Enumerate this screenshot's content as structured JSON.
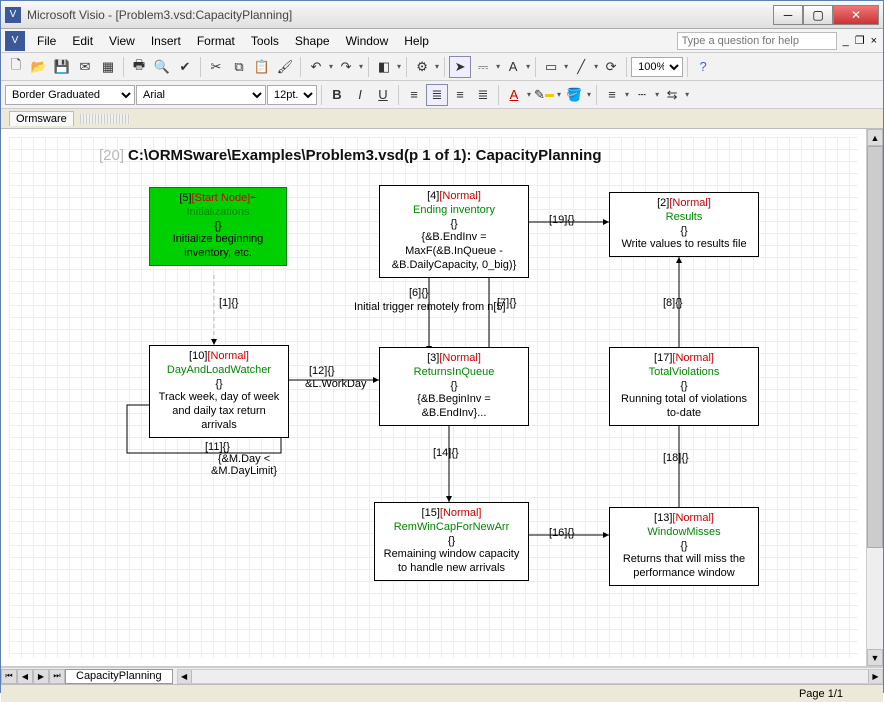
{
  "title_bar": {
    "title": "Microsoft Visio - [Problem3.vsd:CapacityPlanning]"
  },
  "menu": {
    "items": [
      "File",
      "Edit",
      "View",
      "Insert",
      "Format",
      "Tools",
      "Shape",
      "Window",
      "Help"
    ],
    "help_placeholder": "Type a question for help"
  },
  "toolbar": {
    "zoom": "100%"
  },
  "format_bar": {
    "style": "Border Graduated",
    "font": "Arial",
    "size": "12pt."
  },
  "shapes": {
    "tab": "Ormsware"
  },
  "document": {
    "prefix": "[20]",
    "path": "C:\\ORMSware\\Examples\\Problem3.vsd(p 1 of 1): CapacityPlanning"
  },
  "nodes": {
    "n5": {
      "id": "[5]",
      "type": "[Start Node]",
      "tilde": "~",
      "name": "Initializations",
      "br": "{}",
      "desc": "Initialize beginning inventory, etc."
    },
    "n4": {
      "id": "[4]",
      "type": "[Normal]",
      "name": "Ending inventory",
      "br": "{}",
      "desc": "{&B.EndInv = MaxF(&B.InQueue - &B.DailyCapacity, 0_big)}"
    },
    "n2": {
      "id": "[2]",
      "type": "[Normal]",
      "name": "Results",
      "br": "{}",
      "desc": "Write values to results file"
    },
    "n10": {
      "id": "[10]",
      "type": "[Normal]",
      "name": "DayAndLoadWatcher",
      "br": "{}",
      "desc": "Track week, day of week and daily tax return arrivals"
    },
    "n3": {
      "id": "[3]",
      "type": "[Normal]",
      "name": "ReturnsInQueue",
      "br": "{}",
      "desc": "{&B.BeginInv = &B.EndInv}..."
    },
    "n17": {
      "id": "[17]",
      "type": "[Normal]",
      "name": "TotalViolations",
      "br": "{}",
      "desc": "Running total of violations to-date"
    },
    "n15": {
      "id": "[15]",
      "type": "[Normal]",
      "name": "RemWinCapForNewArr",
      "br": "{}",
      "desc": "Remaining window capacity to handle new arrivals"
    },
    "n13": {
      "id": "[13]",
      "type": "[Normal]",
      "name": "WindowMisses",
      "br": "{}",
      "desc": "Returns that will miss the performance window"
    }
  },
  "edges": {
    "e1": {
      "id": "[1]",
      "txt": "{}"
    },
    "e6": {
      "id": "[6]",
      "txt": "{}",
      "sub": "Initial trigger remotely from n[5]"
    },
    "e7": {
      "id": "[7]",
      "txt": "{}"
    },
    "e8": {
      "id": "[8]",
      "txt": "{}"
    },
    "e11": {
      "id": "[11]",
      "txt": "{}",
      "sub": "{&M.Day < &M.DayLimit}"
    },
    "e12": {
      "id": "[12]",
      "txt": "{}",
      "sub": "&L.WorkDay"
    },
    "e14": {
      "id": "[14]",
      "txt": "{}"
    },
    "e16": {
      "id": "[16]",
      "txt": "{}"
    },
    "e18": {
      "id": "[18]",
      "txt": "{}"
    },
    "e19": {
      "id": "[19]",
      "txt": "{}"
    }
  },
  "page_tab": {
    "label": "CapacityPlanning"
  },
  "status": {
    "page": "Page 1/1"
  }
}
